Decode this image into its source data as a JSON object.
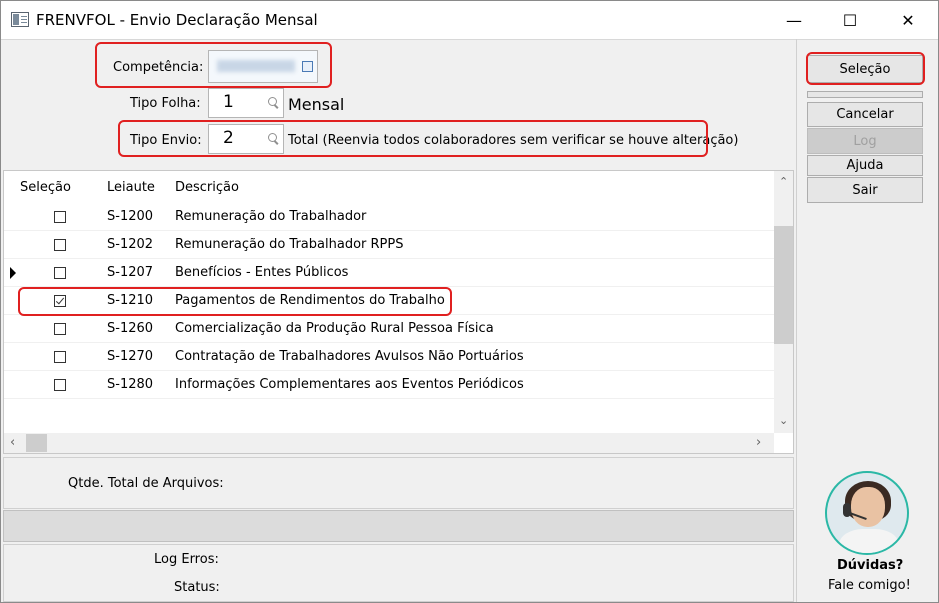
{
  "window": {
    "title": "FRENVFOL - Envio Declaração Mensal",
    "controls": {
      "minimize": "—",
      "maximize": "☐",
      "close": "✕"
    }
  },
  "form": {
    "competencia": {
      "label": "Competência:",
      "value": ""
    },
    "tipo_folha": {
      "label": "Tipo Folha:",
      "value": "1",
      "description": "Mensal"
    },
    "tipo_envio": {
      "label": "Tipo Envio:",
      "value": "2",
      "description": "Total (Reenvia todos colaboradores sem verificar se houve alteração)"
    }
  },
  "buttons": {
    "selecao": "Seleção",
    "cancelar": "Cancelar",
    "log": "Log",
    "ajuda": "Ajuda",
    "sair": "Sair"
  },
  "grid": {
    "columns": [
      "Seleção",
      "Leiaute",
      "Descrição"
    ],
    "rows": [
      {
        "checked": false,
        "leiaute": "S-1200",
        "descricao": "Remuneração do Trabalhador",
        "current": false
      },
      {
        "checked": false,
        "leiaute": "S-1202",
        "descricao": "Remuneração do Trabalhador RPPS",
        "current": false
      },
      {
        "checked": false,
        "leiaute": "S-1207",
        "descricao": "Benefícios - Entes Públicos",
        "current": true
      },
      {
        "checked": true,
        "leiaute": "S-1210",
        "descricao": "Pagamentos de Rendimentos do Trabalho",
        "current": false
      },
      {
        "checked": false,
        "leiaute": "S-1260",
        "descricao": "Comercialização da Produção Rural Pessoa Física",
        "current": false
      },
      {
        "checked": false,
        "leiaute": "S-1270",
        "descricao": "Contratação de Trabalhadores Avulsos Não Portuários",
        "current": false
      },
      {
        "checked": false,
        "leiaute": "S-1280",
        "descricao": "Informações Complementares aos Eventos Periódicos",
        "current": false
      }
    ]
  },
  "footer": {
    "qtde_label": "Qtde. Total de Arquivos:",
    "log_erros_label": "Log Erros:",
    "status_label": "Status:"
  },
  "help": {
    "line1": "Dúvidas?",
    "line2": "Fale comigo!"
  },
  "colors": {
    "highlight": "#e02020",
    "avatar_ring": "#2bb8a6"
  }
}
